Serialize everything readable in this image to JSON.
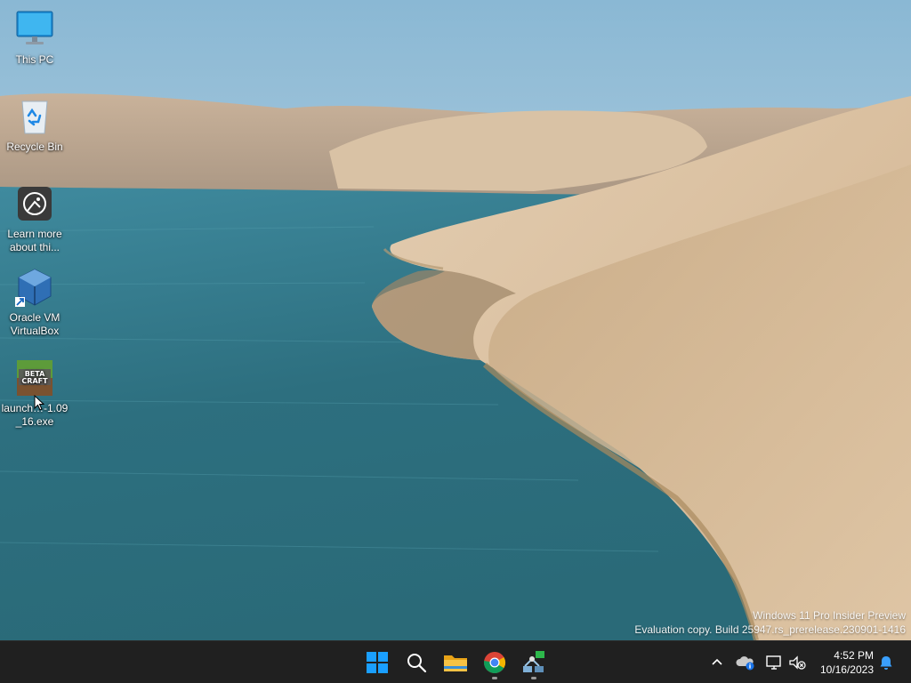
{
  "desktop": {
    "icons": [
      {
        "label": "This PC",
        "icon": "monitor-icon"
      },
      {
        "label": "Recycle Bin",
        "icon": "recycle-bin-icon"
      },
      {
        "label": "Learn more\nabout thi...",
        "icon": "learn-more-icon"
      },
      {
        "label": "Oracle VM\nVirtualBox",
        "icon": "virtualbox-icon"
      },
      {
        "label": "launch…-1.09\n_16.exe",
        "icon": "betacraft-icon"
      }
    ]
  },
  "watermark": {
    "line1": "Windows 11 Pro Insider Preview",
    "line2": "Evaluation copy. Build 25947.rs_prerelease.230901-1416"
  },
  "taskbar": {
    "apps": [
      {
        "name": "Start",
        "icon": "windows-start-icon"
      },
      {
        "name": "Search",
        "icon": "search-icon"
      },
      {
        "name": "File Explorer",
        "icon": "folder-icon"
      },
      {
        "name": "Google Chrome",
        "icon": "chrome-icon",
        "running": true
      },
      {
        "name": "Network app",
        "icon": "network-app-icon",
        "running": true
      }
    ],
    "tray": {
      "icons": [
        "chevron-up-icon",
        "onedrive-icon",
        "display-icon",
        "speaker-muted-icon"
      ],
      "time": "4:52 PM",
      "date": "10/16/2023",
      "notification_icon": "bell-icon"
    }
  },
  "colors": {
    "taskbar_bg": "#202020",
    "start_blue": "#1a9fff",
    "folder_yellow": "#f6c244"
  }
}
